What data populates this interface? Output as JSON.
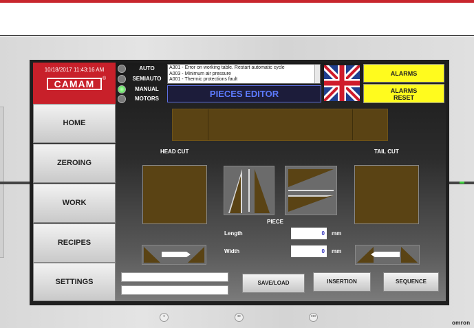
{
  "status": {
    "datetime": "10/18/2017 11:43:16 AM",
    "brand": "CAMAM",
    "brand_mark": "®"
  },
  "modes": [
    {
      "label": "AUTO",
      "active": false
    },
    {
      "label": "SEMIAUTO",
      "active": false
    },
    {
      "label": "MANUAL",
      "active": true
    },
    {
      "label": "MOTORS",
      "active": false
    }
  ],
  "alarms_list": [
    "A301 - Error on working table. Restart automatic cycle",
    "A003 - Minimum air pressure",
    "A001 - Thermic protections fault"
  ],
  "page_title": "PIECES EDITOR",
  "language_flag": "uk-flag-icon",
  "buttons": {
    "alarms": "ALARMS",
    "alarms_reset_1": "ALARMS",
    "alarms_reset_2": "RESET",
    "save_load": "SAVE/LOAD",
    "insertion": "INSERTION",
    "sequence": "SEQUENCE"
  },
  "nav": [
    "HOME",
    "ZEROING",
    "WORK",
    "RECIPES",
    "SETTINGS"
  ],
  "editor": {
    "head_cut_label": "HEAD CUT",
    "tail_cut_label": "TAIL CUT",
    "piece_label": "PIECE",
    "length_label": "Length",
    "length_value": "0",
    "length_unit": "mm",
    "width_label": "Width",
    "width_value": "0",
    "width_unit": "mm"
  },
  "device": {
    "vendor": "omron",
    "dots": [
      "•",
      "••",
      "•••"
    ]
  },
  "colors": {
    "brand_red": "#c8202a",
    "alarm_yellow": "#fffb1e",
    "title_blue": "#5d7bff",
    "profile_brown": "#5a4314"
  }
}
